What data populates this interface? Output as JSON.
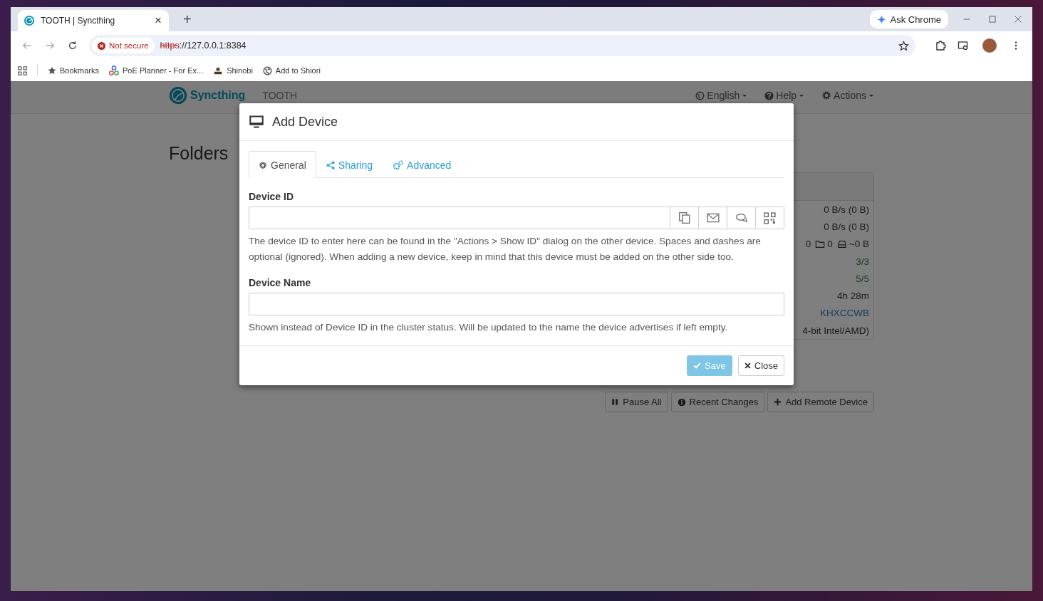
{
  "browser": {
    "tab": {
      "title": "TOOTH | Syncthing",
      "close": "×"
    },
    "new_tab": "+",
    "ask_chrome": "Ask Chrome",
    "security": "Not secure",
    "url_scheme": "https",
    "url_rest": "://127.0.0.1:8384",
    "bookmarks": [
      {
        "label": "Bookmarks"
      },
      {
        "label": "PoE Planner - For Ex..."
      },
      {
        "label": "Shinobi"
      },
      {
        "label": "Add to Shiori"
      }
    ]
  },
  "navbar": {
    "brand": "Syncthing",
    "device": "TOOTH",
    "menus": [
      {
        "label": "English"
      },
      {
        "label": "Help"
      },
      {
        "label": "Actions"
      }
    ]
  },
  "folders": {
    "heading": "Folders"
  },
  "this_device": {
    "rows": [
      {
        "kind": "plain",
        "value": "0 B/s (0 B)"
      },
      {
        "kind": "plain",
        "value": "0 B/s (0 B)"
      },
      {
        "kind": "counts",
        "files": "0",
        "folders": "0",
        "size": "~0 B"
      },
      {
        "kind": "ok",
        "value": "3/3"
      },
      {
        "kind": "ok",
        "value": "5/5"
      },
      {
        "kind": "plain",
        "value": "4h 28m"
      },
      {
        "kind": "link",
        "value": "KHXCCWB"
      },
      {
        "kind": "plain",
        "value": "4-bit Intel/AMD)"
      }
    ]
  },
  "device_buttons": [
    {
      "label": "Pause All"
    },
    {
      "label": "Recent Changes"
    },
    {
      "label": "Add Remote Device"
    }
  ],
  "modal": {
    "title": "Add Device",
    "tabs": [
      {
        "label": "General",
        "selected": true
      },
      {
        "label": "Sharing",
        "selected": false
      },
      {
        "label": "Advanced",
        "selected": false
      }
    ],
    "device_id": {
      "label": "Device ID",
      "help": "The device ID to enter here can be found in the \"Actions > Show ID\" dialog on the other device. Spaces and dashes are optional (ignored). When adding a new device, keep in mind that this device must be added on the other side too."
    },
    "device_name": {
      "label": "Device Name",
      "help": "Shown instead of Device ID in the cluster status. Will be updated to the name the device advertises if left empty."
    },
    "buttons": [
      {
        "label": "Save",
        "kind": "primary",
        "disabled": true
      },
      {
        "label": "Close",
        "kind": "default",
        "disabled": false
      }
    ]
  }
}
